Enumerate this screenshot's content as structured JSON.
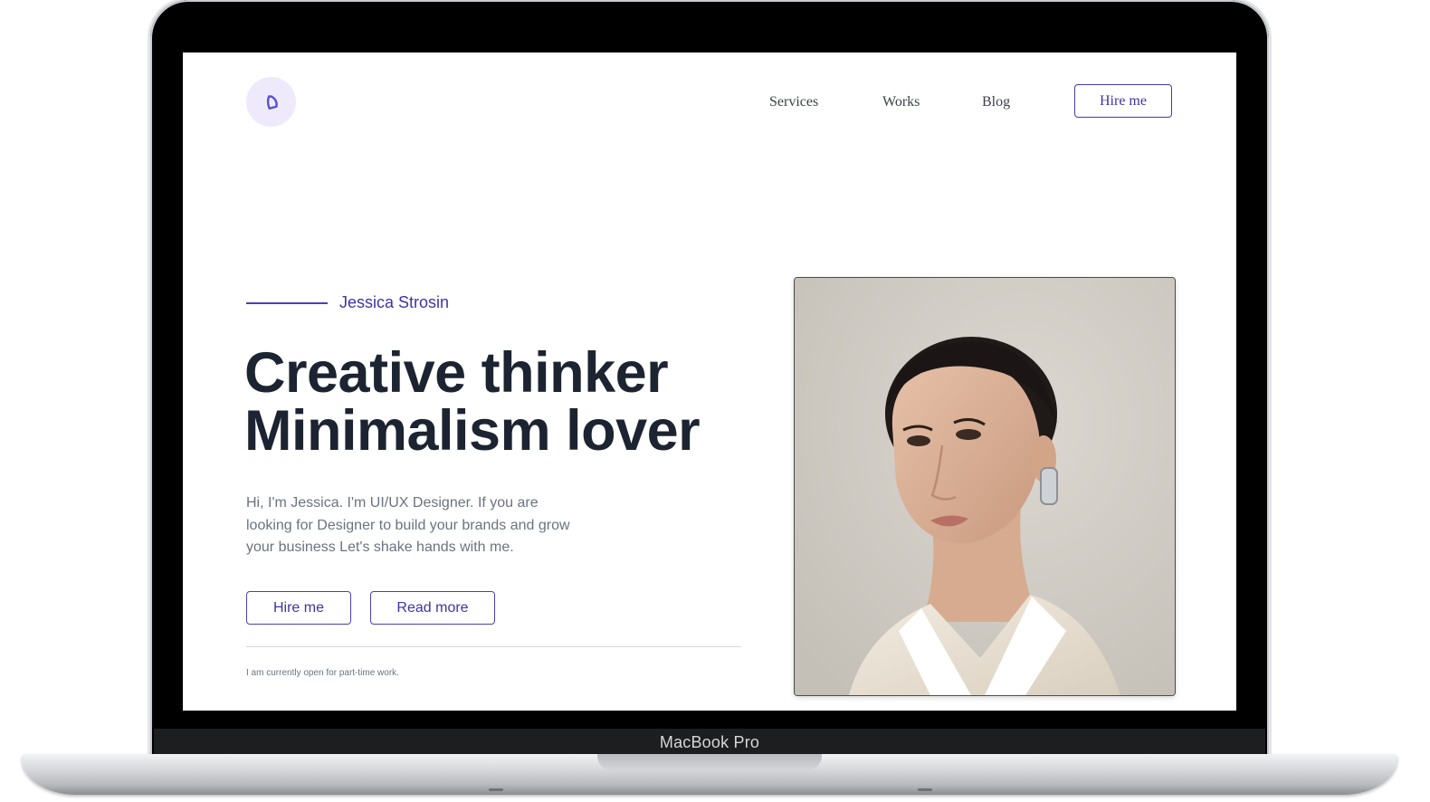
{
  "device": {
    "label": "MacBook Pro"
  },
  "header": {
    "logo_icon": "brand-logo-icon",
    "nav": [
      {
        "label": "Services"
      },
      {
        "label": "Works"
      },
      {
        "label": "Blog"
      }
    ],
    "cta_label": "Hire me"
  },
  "hero": {
    "eyebrow": "Jessica Strosin",
    "headline_line1": "Creative thinker",
    "headline_line2": "Minimalism lover",
    "intro": "Hi, I'm Jessica. I'm UI/UX Designer. If you are looking for Designer to build your brands and grow your business Let's shake hands with me.",
    "primary_button": "Hire me",
    "secondary_button": "Read more",
    "availability_note": "I am currently open for part-time work."
  },
  "colors": {
    "accent": "#4438b5",
    "heading": "#1c2331",
    "body_text": "#6b7280",
    "logo_bg": "#eeeafc"
  }
}
